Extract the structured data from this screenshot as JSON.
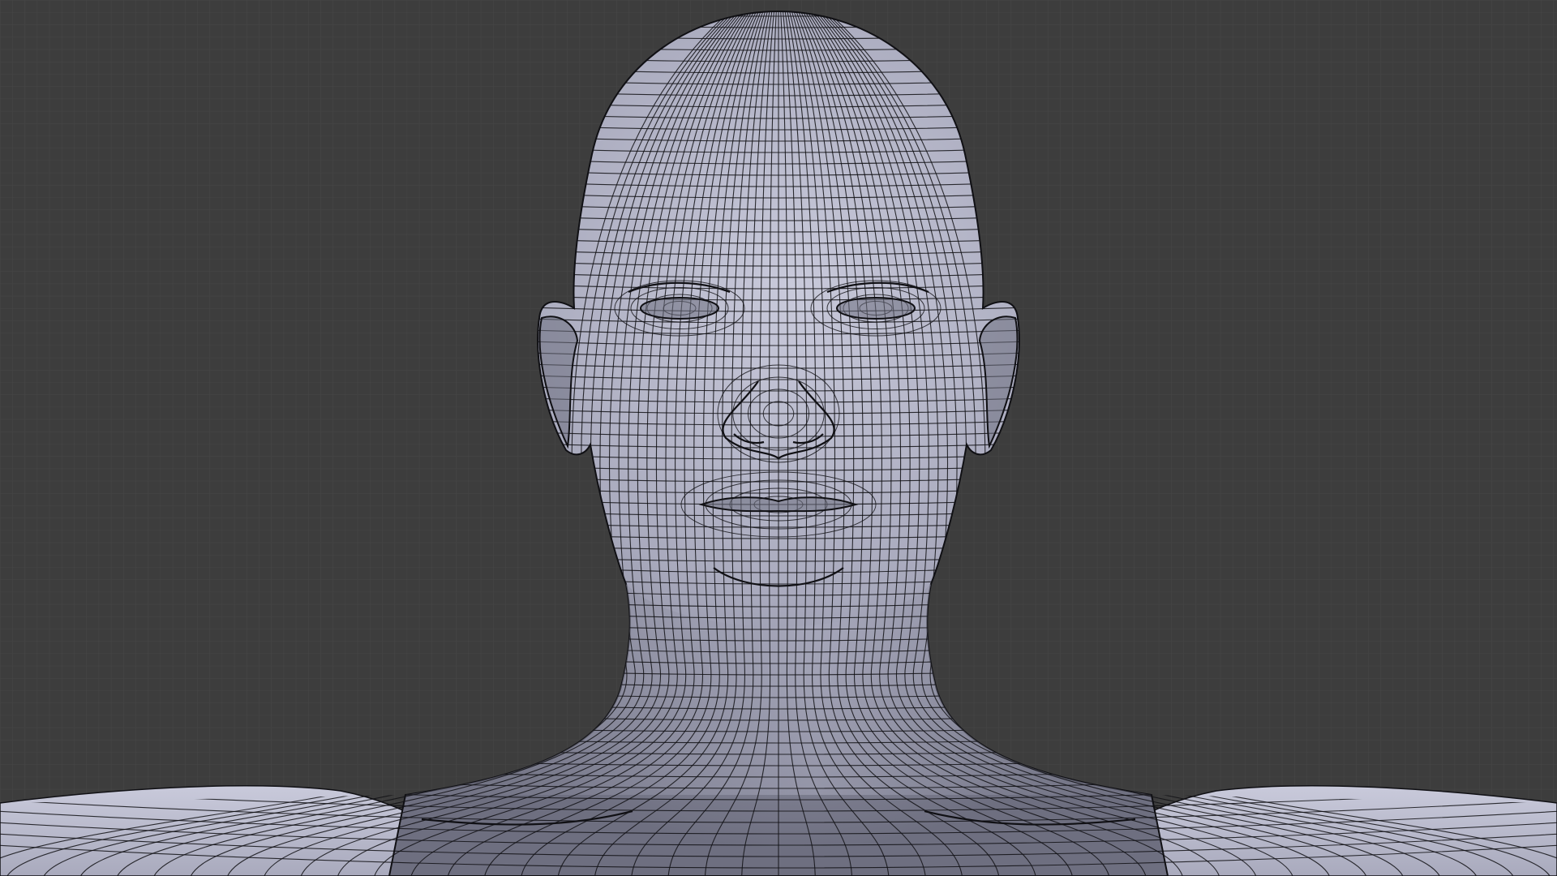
{
  "viewport": {
    "background_color": "#3d3d3d",
    "grid_color": "#464646",
    "mesh_surface_color": "#a9aabd",
    "mesh_highlight_color": "#c9cadb",
    "mesh_shadow_color": "#6e6f80",
    "wireframe_color": "#101014",
    "object": "head-bust-mesh",
    "display_mode": "solid-wireframe",
    "view": "front"
  }
}
